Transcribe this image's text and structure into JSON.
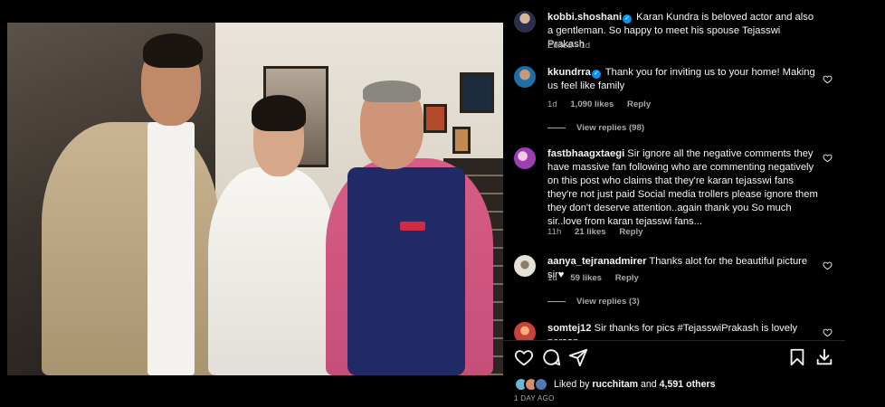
{
  "post": {
    "image_alt": "Group photo of three people at a home gathering",
    "tag_icon": "user-tag-icon"
  },
  "comments": [
    {
      "username": "kobbi.shoshani",
      "verified": true,
      "text": "Karan Kundra is beloved actor and also a gentleman. So happy to meet his spouse Tejasswi Prakash",
      "edited": "Edited",
      "time": "1d",
      "avatar_color": "#5b4aa0"
    },
    {
      "username": "kkundrra",
      "verified": true,
      "text": "Thank you for inviting us to your home! Making us feel like family",
      "time": "1d",
      "likes": "1,090 likes",
      "reply": "Reply",
      "view_replies": "View replies (98)",
      "avatar_color": "#3a8fcf"
    },
    {
      "username": "fastbhaagxtaegi",
      "verified": false,
      "text": "Sir ignore all the negative comments they have massive fan following who are commenting negatively on this post who claims that they're karan tejasswi fans they're not just paid Social media trollers please ignore them they don't deserve attention..again thank you So much sir..love from karan tejasswi fans...",
      "time": "11h",
      "likes": "21 likes",
      "reply": "Reply",
      "avatar_color": "#b44dc7"
    },
    {
      "username": "aanya_tejranadmirer",
      "verified": false,
      "text": "Thanks alot for the beautiful picture sir♥",
      "time": "1d",
      "likes": "59 likes",
      "reply": "Reply",
      "view_replies": "View replies (3)",
      "avatar_color": "#d9d4ca"
    },
    {
      "username": "somtej12",
      "verified": false,
      "text": "Sir thanks for pics #TejasswiPrakash is lovely person",
      "avatar_color": "#c8423b"
    }
  ],
  "actions": {
    "like": "heart-icon",
    "comment": "comment-icon",
    "share": "share-icon",
    "save": "bookmark-icon",
    "download": "download-icon"
  },
  "likes_summary": {
    "prefix": "Liked by",
    "user": "rucchitam",
    "and": "and",
    "others": "4,591 others"
  },
  "time_ago": "1 DAY AGO",
  "colors": {
    "background": "#000000",
    "text": "#f5f5f5",
    "muted": "#a8a8a8",
    "verified": "#0095f6"
  }
}
